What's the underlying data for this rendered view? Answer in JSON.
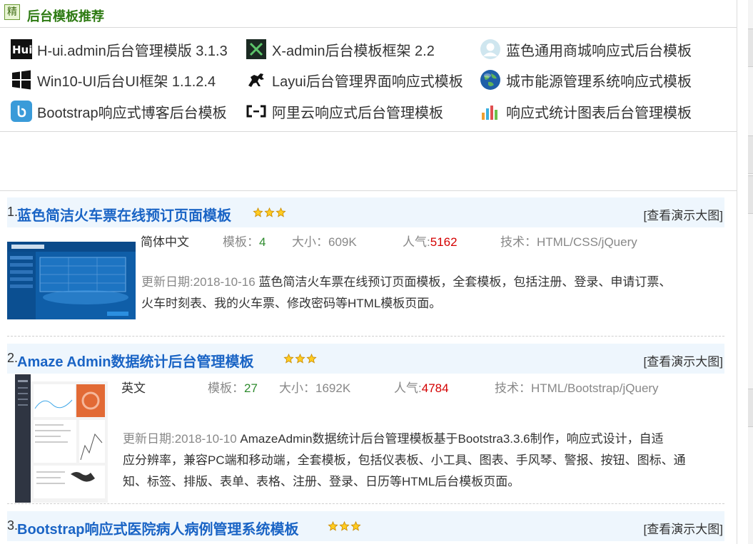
{
  "section": {
    "badge": "精",
    "title": "后台模板推荐"
  },
  "links": [
    {
      "label": "H-ui.admin后台管理模版 3.1.3",
      "icon": "hui-logo-icon"
    },
    {
      "label": "X-admin后台模板框架 2.2",
      "icon": "x-admin-logo-icon"
    },
    {
      "label": "蓝色通用商城响应式后台模板",
      "icon": "user-avatar-icon"
    },
    {
      "label": "Win10-UI后台UI框架 1.1.2.4",
      "icon": "windows-logo-icon"
    },
    {
      "label": "Layui后台管理界面响应式模板",
      "icon": "horse-icon"
    },
    {
      "label": "城市能源管理系统响应式模板",
      "icon": "globe-icon"
    },
    {
      "label": "Bootstrap响应式博客后台模板",
      "icon": "bootstrap-blog-icon"
    },
    {
      "label": "阿里云响应式后台管理模板",
      "icon": "aliyun-logo-icon"
    },
    {
      "label": "响应式统计图表后台管理模板",
      "icon": "bar-chart-icon"
    }
  ],
  "items": [
    {
      "num": "1.",
      "title": "蓝色简洁火车票在线预订页面模板",
      "rating": 3,
      "demo_link": "[查看演示大图]",
      "lang": "简体中文",
      "tpl_label": "模板：",
      "tpl_count": "4",
      "size_label": "大小：",
      "size": "609K",
      "pop_label": "人气:",
      "pop": "5162",
      "tech_label": "技术：",
      "tech": "HTML/CSS/jQuery",
      "date": "更新日期:2018-10-16",
      "desc_line1": "蓝色简洁火车票在线预订页面模板，全套模板，包括注册、登录、申请订票、",
      "desc_line2": "火车时刻表、我的火车票、修改密码等HTML模板页面。"
    },
    {
      "num": "2.",
      "title": "Amaze Admin数据统计后台管理模板",
      "rating": 3,
      "demo_link": "[查看演示大图]",
      "lang": "英文",
      "tpl_label": "模板：",
      "tpl_count": "27",
      "size_label": "大小：",
      "size": "1692K",
      "pop_label": "人气:",
      "pop": "4784",
      "tech_label": "技术：",
      "tech": "HTML/Bootstrap/jQuery",
      "date": "更新日期:2018-10-10",
      "desc_line1": "AmazeAdmin数据统计后台管理模板基于Bootstra3.3.6制作，响应式设计，自适",
      "desc_line2": "应分辨率，兼容PC端和移动端，全套模板，包括仪表板、小工具、图表、手风琴、警报、按钮、图标、通",
      "desc_line3": "知、标签、排版、表单、表格、注册、登录、日历等HTML后台模板页面。"
    },
    {
      "num": "3.",
      "title": "Bootstrap响应式医院病人病例管理系统模板",
      "rating": 3,
      "demo_link": "[查看演示大图]"
    }
  ]
}
